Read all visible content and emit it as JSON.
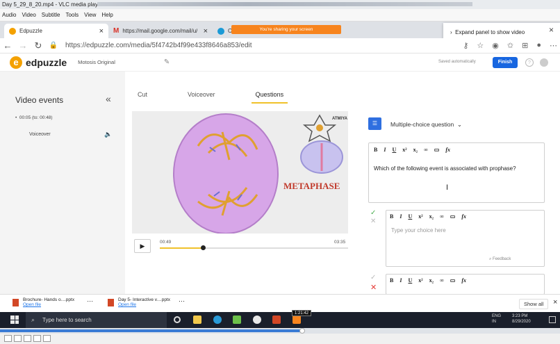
{
  "vlc": {
    "title": "Day 5_29_8_20.mp4 - VLC media player",
    "menu": [
      "Audio",
      "Video",
      "Subtitle",
      "Tools",
      "View",
      "Help"
    ],
    "time_tooltip": "1:21:42",
    "seek_progress": 0.54
  },
  "browser": {
    "tabs": [
      {
        "label": "Edpuzzle",
        "close": "×"
      },
      {
        "label": "https://mail.google.com/mail/u/",
        "close": "×"
      },
      {
        "label": "Cisco"
      }
    ],
    "sharing_notice": "You're sharing your screen",
    "expand_panel": "Expand panel to show video",
    "expand_close": "×",
    "url": "https://edpuzzle.com/media/5f4742b4f99e433f8646a853/edit"
  },
  "app": {
    "logo": "edpuzzle",
    "video_title": "Motosis Original",
    "saved": "Saved automatically",
    "finish": "Finish",
    "help": "?"
  },
  "sidebar": {
    "title": "Video events",
    "collapse": "«",
    "event_time": "00:05 (to: 00:48)",
    "event_label": "Voiceover"
  },
  "editor_tabs": [
    "Cut",
    "Voiceover",
    "Questions"
  ],
  "video": {
    "label_metaphase": "METAPHASE",
    "brand": "ATMIYA",
    "current": "00:49",
    "total": "03:35",
    "progress": 0.227
  },
  "question": {
    "type": "Multiple-choice question",
    "toolbar": [
      "B",
      "I",
      "U",
      "x²",
      "x₂",
      "∞",
      "▭",
      "fx"
    ],
    "text": "Which of the following event is associated with prophase?",
    "choice_placeholder": "Type your choice here",
    "feedback": "Feedback"
  },
  "downloads": [
    {
      "name": "Brochure- Hands o....pptx",
      "link": "Open file"
    },
    {
      "name": "Day 5- Interactive v....pptx",
      "link": "Open file"
    }
  ],
  "downloads_show_all": "Show all",
  "downloads_close": "×",
  "taskbar": {
    "search": "Type here to search",
    "lang": "ENG",
    "region": "IN",
    "time": "3:23 PM",
    "date": "8/29/2020"
  }
}
